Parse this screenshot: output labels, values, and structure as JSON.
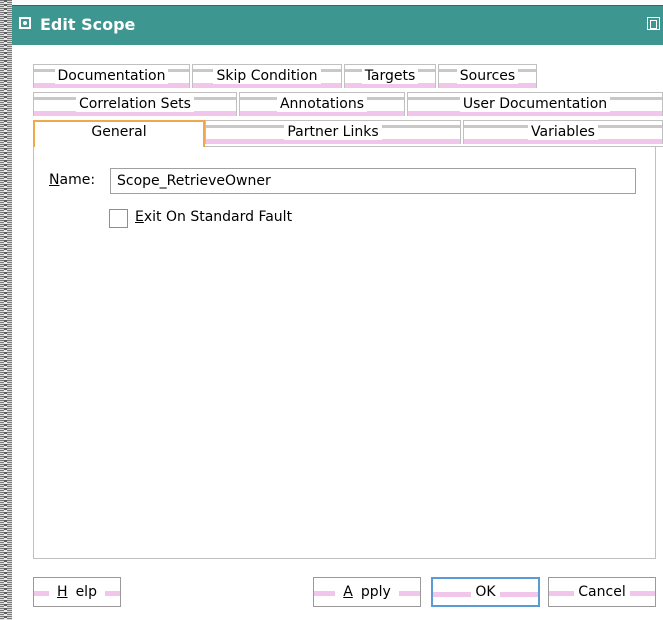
{
  "window": {
    "title": "Edit Scope"
  },
  "tabs": {
    "row1": [
      "Documentation",
      "Skip Condition",
      "Targets",
      "Sources"
    ],
    "row2": [
      "Correlation Sets",
      "Annotations",
      "User Documentation"
    ],
    "row3": [
      "General",
      "Partner Links",
      "Variables"
    ],
    "selected": "General"
  },
  "form": {
    "name_label_mnemonic": "N",
    "name_label_rest": "ame:",
    "name_value": "Scope_RetrieveOwner",
    "exit_checkbox_mnemonic": "E",
    "exit_checkbox_rest": "xit On Standard Fault",
    "exit_checked": false
  },
  "buttons": {
    "help_mnemonic": "H",
    "help_rest": "elp",
    "apply_mnemonic": "A",
    "apply_rest": "pply",
    "ok": "OK",
    "cancel": "Cancel"
  }
}
